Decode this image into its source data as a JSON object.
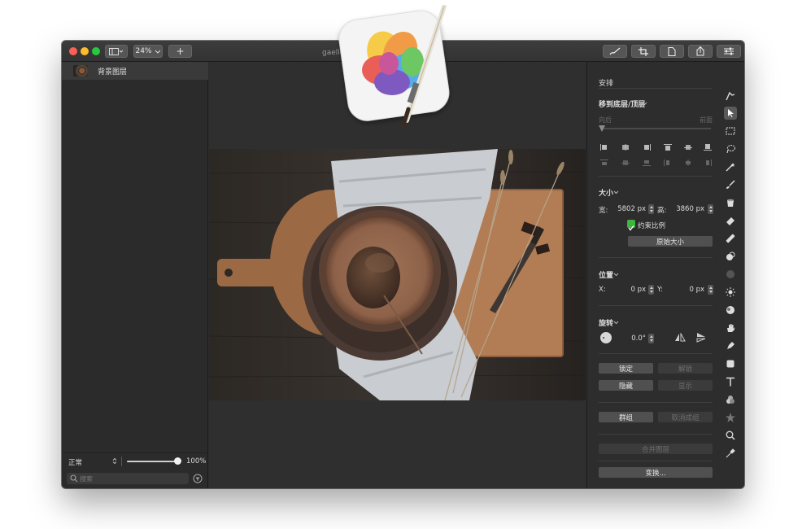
{
  "window": {
    "title": "gaelle-marcel-...sh — 已编辑",
    "zoom": "24%",
    "traffic_colors": [
      "#fe5f57",
      "#febc2e",
      "#28c840"
    ]
  },
  "toolbar": {
    "view_icon": "sidebar-toggle-icon",
    "add_label": "+",
    "right_buttons": [
      "brush-icon",
      "crop-icon",
      "document-icon",
      "share-icon",
      "adjust-icon"
    ]
  },
  "layers": {
    "items": [
      {
        "name": "背景图层"
      }
    ],
    "blend_mode": "正常",
    "opacity": "100%",
    "search_placeholder": "搜索"
  },
  "inspector": {
    "tab": "安排",
    "arrange": {
      "title": "移到底层/顶层",
      "back": "向后",
      "front": "前面"
    },
    "size": {
      "title": "大小",
      "width_label": "宽:",
      "width": "5802 px",
      "height_label": "高:",
      "height": "3860 px",
      "constrain": "约束比例",
      "constrain_checked": true,
      "original_size": "原始大小"
    },
    "position": {
      "title": "位置",
      "x_label": "X:",
      "x": "0 px",
      "y_label": "Y:",
      "y": "0 px"
    },
    "rotate": {
      "title": "旋转",
      "angle": "0.0°"
    },
    "buttons": {
      "lock": "锁定",
      "unlock": "解锁",
      "hide": "隐藏",
      "show": "显示",
      "group": "群组",
      "ungroup": "取消成组",
      "merge": "合并图层",
      "transform": "变换..."
    }
  },
  "tools": [
    "arrange-tool-icon",
    "pointer-icon",
    "marquee-icon",
    "lasso-icon",
    "magic-wand-icon",
    "brush-icon",
    "bucket-icon",
    "eraser-icon",
    "retouch-icon",
    "clone-icon",
    "blur-icon",
    "sun-icon",
    "distort-icon",
    "hand-icon",
    "pen-icon",
    "shape-icon",
    "text-icon",
    "color-icon",
    "star-icon",
    "zoom-icon",
    "eyedropper-icon"
  ],
  "colors": {
    "window_bg": "#2d2d2d",
    "checkbox_green": "#3fb43f",
    "accent": "#e8e8e8"
  }
}
